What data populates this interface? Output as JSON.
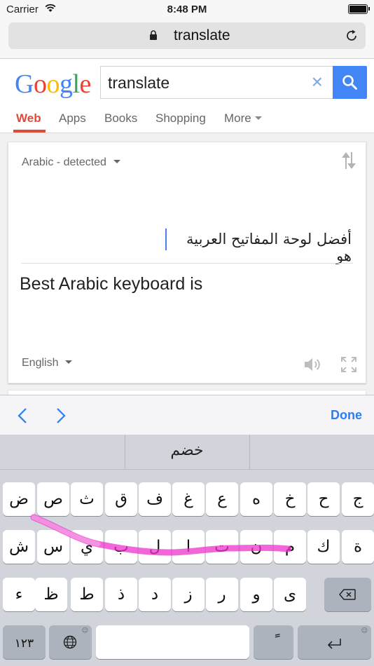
{
  "status_bar": {
    "carrier": "Carrier",
    "time": "8:48 PM"
  },
  "browser": {
    "url": "translate"
  },
  "google": {
    "logo": "Google",
    "query": "translate",
    "tabs": [
      {
        "label": "Web",
        "active": true
      },
      {
        "label": "Apps"
      },
      {
        "label": "Books"
      },
      {
        "label": "Shopping"
      },
      {
        "label": "More"
      }
    ]
  },
  "translate": {
    "source_language": "Arabic - detected",
    "source_text": "أفضل لوحة المفاتيح العربية هو",
    "result_text": "Best Arabic keyboard is",
    "target_language": "English"
  },
  "accessory": {
    "done_label": "Done"
  },
  "keyboard": {
    "suggestion": "خضم",
    "row1": [
      "ض",
      "ص",
      "ث",
      "ق",
      "ف",
      "غ",
      "ع",
      "ه",
      "خ",
      "ح",
      "ج"
    ],
    "row2": [
      "ش",
      "س",
      "ي",
      "ب",
      "ل",
      "ا",
      "ت",
      "ن",
      "م",
      "ك",
      "ة"
    ],
    "row3": [
      "ء",
      "ظ",
      "ط",
      "ذ",
      "د",
      "ز",
      "ر",
      "و",
      "ى"
    ],
    "numbers_label": "١٢٣",
    "space_label": "",
    "diacritic_label": "ً",
    "colors": {
      "swipe_trail": "#ee33cc",
      "accent": "#2a7ef0"
    }
  }
}
